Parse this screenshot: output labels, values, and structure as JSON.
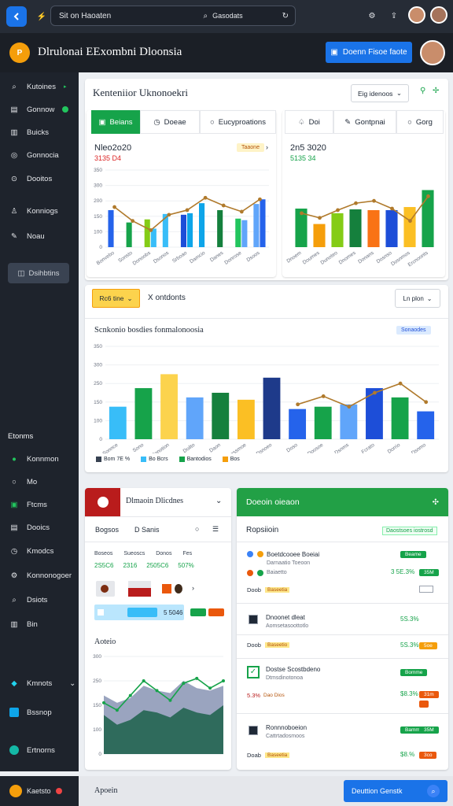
{
  "browser": {
    "tab_title": "Sit on Haoaten",
    "search_text": "Gasodats"
  },
  "header": {
    "title": "Dlrulonai EExombni Dloonsia",
    "button_label": "Doenn Fisoe faote"
  },
  "sidebar": {
    "items": [
      {
        "label": "Kutoines",
        "icon": "search-icon"
      },
      {
        "label": "Gonnow",
        "icon": "inbox-icon"
      },
      {
        "label": "Buicks",
        "icon": "grid-icon"
      },
      {
        "label": "Gonnocia",
        "icon": "globe-icon"
      },
      {
        "label": "Dooitos",
        "icon": "magnifier-icon"
      },
      {
        "label": "Konniogs",
        "icon": "person-icon"
      },
      {
        "label": "Noau",
        "icon": "edit-icon"
      }
    ],
    "action_label": "Dsihbtins",
    "section_label": "Etonms",
    "section_items": [
      {
        "label": "Konnmon",
        "icon": "leaf-icon"
      },
      {
        "label": "Mo",
        "icon": "circle-icon"
      },
      {
        "label": "Ftcms",
        "icon": "note-icon"
      },
      {
        "label": "Dooics",
        "icon": "list-icon"
      },
      {
        "label": "Kmodcs",
        "icon": "clock-icon"
      },
      {
        "label": "Konnonogoer",
        "icon": "gear-icon"
      },
      {
        "label": "Dsiots",
        "icon": "search-icon"
      },
      {
        "label": "Bin",
        "icon": "book-icon"
      }
    ],
    "footer_items": [
      {
        "label": "Kmnots",
        "icon": "tag-icon"
      },
      {
        "label": "Bssnop",
        "icon": "square-icon"
      },
      {
        "label": "Ertnorns",
        "icon": "globe-icon"
      }
    ],
    "user_label": "Kaetsto"
  },
  "overview": {
    "title": "Kenteniior Uknonoekri",
    "dropdown": "Eig idenoos",
    "left_tabs": [
      "Beians",
      "Doeae",
      "Eucyproations"
    ],
    "right_tabs": [
      "Doi",
      "Gontpnai",
      "Gorg"
    ],
    "left_chart_title": "Nleo2o20",
    "left_chart_sub": "3135 D4",
    "left_chart_badge": "Taaone",
    "right_chart_title": "2n5 3020",
    "right_chart_sub": "5135 34"
  },
  "middle": {
    "filter_label": "Rc6 tine",
    "second_label": "X ontdonts",
    "select_label": "Ln plon",
    "chart_title": "Scnkonio bosdies fonmalonoosia",
    "chip": "Sonaodes",
    "legend": [
      "Bom 7E %",
      "Bo Bcrs",
      "Bantodios",
      "Bos"
    ]
  },
  "lower_left": {
    "title": "Dlmaoin Dlicdnes",
    "cols": [
      "Bogsos",
      "D Sanis"
    ],
    "labels": [
      "Boseos",
      "Sueoscs",
      "Donos",
      "Fes"
    ],
    "values": [
      "2S5C6",
      "2316",
      "2505C6",
      "507%"
    ],
    "price": "5 5046",
    "area_title": "Aoteio"
  },
  "lower_right": {
    "title": "Doeoin oieaon",
    "section": "Ropsiioin",
    "section_badge": "Daostsoes iostrosd",
    "entries": [
      {
        "name": "Boetdcooee Boeiai",
        "sub": "Darnaatio Toeoon",
        "sub2": "Baiaetto",
        "action": "Beame",
        "value": "3 5E.3%",
        "pill": "35M",
        "footer": "Doob",
        "footer_badge": "Baseetia"
      },
      {
        "name": "Dnoonet dleat",
        "sub": "Aomsetasoottotlo",
        "value": "5S.3%",
        "pill": "5oe",
        "footer": "Doob",
        "footer_badge": "Baseetio"
      },
      {
        "name": "Dostse Scostbdeno",
        "sub": "Dtmsdinotonoa",
        "value": "$8.3%",
        "pill": "31m",
        "footer": "5.3%",
        "footer_badge": "Dao Dios",
        "action": "Bomme"
      },
      {
        "name": "Ronnnoboeion",
        "sub": "Cattrtadosmoos",
        "value": "$8.%",
        "pill": "3co",
        "footer": "Doab",
        "footer_badge": "Baseetia",
        "action": "Bamme"
      }
    ]
  },
  "bottom": {
    "label": "Apoein",
    "button": "Deuttion Genstk"
  },
  "colors": {
    "accent": "#1a73e8",
    "green": "#16a34a",
    "dark": "#1e232c",
    "amber": "#f59e0b"
  },
  "chart_data": [
    {
      "type": "bar",
      "title": "Nleo2o20",
      "ylim": [
        0,
        500
      ],
      "yticks": [
        "0",
        "100",
        "150",
        "200",
        "300",
        "350"
      ],
      "categories": [
        "Bonvebo",
        "Sonsto",
        "Donoobs",
        "Dsonos",
        "Srboao",
        "Damcio",
        "Danes",
        "Donrose",
        "Dsoos"
      ],
      "series": [
        {
          "values": [
            240,
            160,
            180,
            215,
            210,
            285,
            240,
            185,
            280
          ],
          "color": "#2563eb"
        },
        {
          "values": [
            0,
            0,
            120,
            0,
            220,
            0,
            0,
            175,
            310
          ],
          "color": "#16a34a"
        },
        {
          "line": true,
          "values": [
            260,
            170,
            110,
            210,
            240,
            320,
            270,
            230,
            310
          ],
          "color": "#b07a2c"
        }
      ]
    },
    {
      "type": "bar",
      "title": "2n5 3020",
      "ylim": [
        0,
        500
      ],
      "categories": [
        "Dnoem",
        "Doumes",
        "Dunoteo",
        "Dnomes",
        "Donans",
        "Dosnso",
        "Dosnmos",
        "Ercnoonts"
      ],
      "series": [
        {
          "values": [
            250,
            150,
            220,
            245,
            240,
            240,
            260,
            370
          ],
          "color": "#16a34a"
        },
        {
          "line": true,
          "values": [
            220,
            190,
            240,
            285,
            300,
            250,
            170,
            330
          ],
          "color": "#b07a2c"
        }
      ]
    },
    {
      "type": "bar",
      "title": "Scnkonio bosdies fonmalonoosia",
      "ylim": [
        0,
        400
      ],
      "yticks": [
        "0",
        "100",
        "150",
        "250",
        "300",
        "350"
      ],
      "categories": [
        "Sonnce",
        "Sono",
        "Donotion",
        "Doilto",
        "Daon",
        "Dassmoe",
        "Dsnoeo",
        "Doso",
        "Doosoe",
        "Dsnms",
        "Fcrato",
        "Dorrio",
        "Dsnmo"
      ],
      "series": [
        {
          "values": [
            140,
            220,
            280,
            180,
            200,
            170,
            265,
            130,
            140,
            150,
            220,
            180,
            120
          ],
          "color": "#16a34a"
        },
        {
          "line": true,
          "values": [
            0,
            0,
            0,
            0,
            0,
            0,
            0,
            150,
            185,
            140,
            200,
            240,
            160
          ],
          "color": "#b07a2c"
        }
      ]
    },
    {
      "type": "area",
      "title": "Aoteio",
      "ylim": [
        0,
        400
      ],
      "yticks": [
        "0",
        "100",
        "150",
        "250",
        "300"
      ],
      "series": [
        {
          "values": [
            240,
            210,
            230,
            280,
            260,
            250,
            300,
            270,
            260,
            280
          ],
          "color": "#9aa4bf"
        },
        {
          "values": [
            160,
            120,
            140,
            180,
            170,
            150,
            190,
            170,
            160,
            200
          ],
          "color": "#2f6b5c"
        },
        {
          "line": true,
          "values": [
            210,
            180,
            240,
            300,
            260,
            220,
            290,
            310,
            270,
            300
          ],
          "color": "#16a34a"
        }
      ]
    }
  ]
}
